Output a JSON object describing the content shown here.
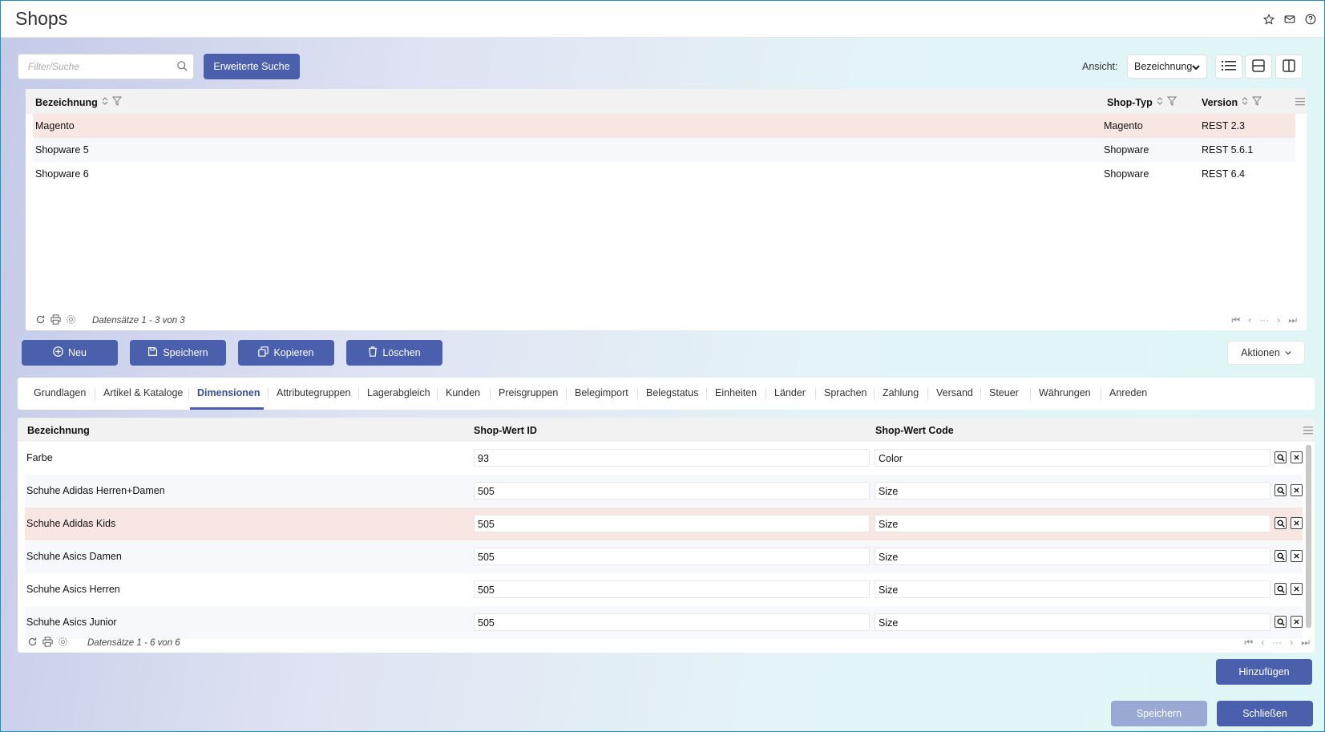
{
  "window": {
    "title": "Shops"
  },
  "search": {
    "placeholder": "Filter/Suche",
    "value": "",
    "advanced_label": "Erweiterte Suche"
  },
  "view": {
    "label": "Ansicht:",
    "selected": "Bezeichnung"
  },
  "grid1": {
    "columns": [
      "Bezeichnung",
      "Shop-Typ",
      "Version"
    ],
    "rows": [
      {
        "name": "Magento",
        "type": "Magento",
        "version": "REST 2.3"
      },
      {
        "name": "Shopware 5",
        "type": "Shopware",
        "version": "REST 5.6.1"
      },
      {
        "name": "Shopware 6",
        "type": "Shopware",
        "version": "REST 6.4"
      }
    ],
    "records": "Datensätze 1 - 3 von 3"
  },
  "actions": {
    "new": "Neu",
    "save": "Speichern",
    "copy": "Kopieren",
    "delete": "Löschen",
    "more": "Aktionen"
  },
  "tabs": [
    "Grundlagen",
    "Artikel & Kataloge",
    "Dimensionen",
    "Attributegruppen",
    "Lagerabgleich",
    "Kunden",
    "Preisgruppen",
    "Belegimport",
    "Belegstatus",
    "Einheiten",
    "Länder",
    "Sprachen",
    "Zahlung",
    "Versand",
    "Steuer",
    "Währungen",
    "Anreden"
  ],
  "active_tab": "Dimensionen",
  "grid2": {
    "columns": [
      "Bezeichnung",
      "Shop-Wert ID",
      "Shop-Wert Code"
    ],
    "rows": [
      {
        "name": "Farbe",
        "id": "93",
        "code": "Color"
      },
      {
        "name": "Schuhe Adidas Herren+Damen",
        "id": "505",
        "code": "Size"
      },
      {
        "name": "Schuhe Adidas Kids",
        "id": "505",
        "code": "Size"
      },
      {
        "name": "Schuhe Asics Damen",
        "id": "505",
        "code": "Size"
      },
      {
        "name": "Schuhe Asics Herren",
        "id": "505",
        "code": "Size"
      },
      {
        "name": "Schuhe Asics Junior",
        "id": "505",
        "code": "Size"
      }
    ],
    "records": "Datensätze 1 - 6 von 6"
  },
  "footer": {
    "add": "Hinzufügen",
    "save": "Speichern",
    "close": "Schließen"
  },
  "colors": {
    "primary": "#4b60ad",
    "selected_row": "#f8e6e3",
    "disabled": "#9aa9d4"
  }
}
